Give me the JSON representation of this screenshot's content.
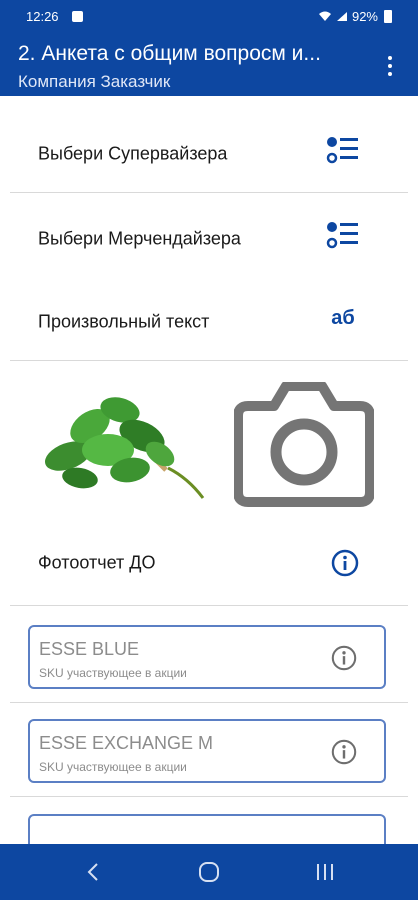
{
  "status_bar": {
    "time": "12:26",
    "battery": "92%"
  },
  "app_bar": {
    "title": "2. Анкета с общим вопросм и...",
    "subtitle": "Компания Заказчик"
  },
  "rows": [
    {
      "label": "Выбери Супервайзера",
      "icon": "list-select-icon"
    },
    {
      "label": "Выбери Мерчендайзера",
      "icon": "list-select-icon"
    },
    {
      "label": "Произвольный текст",
      "icon": "text-icon",
      "icon_text": "аб"
    }
  ],
  "photo_report": {
    "label": "Фотоотчет ДО"
  },
  "sku_items": [
    {
      "name": "ESSE BLUE",
      "hint": "SKU участвующее в акции"
    },
    {
      "name": "ESSE EXCHANGE M",
      "hint": "SKU участвующее в акции"
    },
    {
      "name": "",
      "hint": ""
    }
  ],
  "colors": {
    "primary": "#0d47a1",
    "field_border": "#5b7fc4",
    "muted_text": "#8c8c8c",
    "camera_gray": "#757575"
  }
}
